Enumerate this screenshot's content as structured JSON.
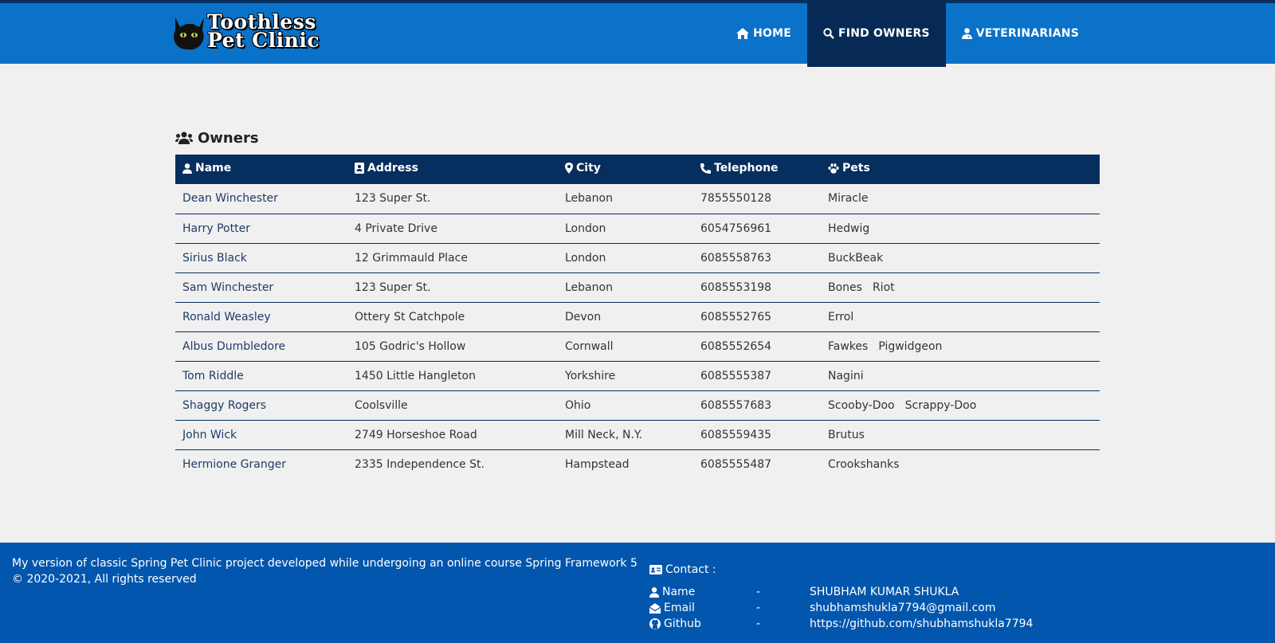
{
  "header": {
    "logo_line1": "Toothless",
    "logo_line2": "Pet Clinic",
    "nav": [
      {
        "label": "HOME",
        "icon": "home-icon"
      },
      {
        "label": "FIND OWNERS",
        "icon": "search-icon",
        "active": true
      },
      {
        "label": "VETERINARIANS",
        "icon": "user-md-icon"
      }
    ]
  },
  "main": {
    "title": "Owners",
    "columns": [
      "Name",
      "Address",
      "City",
      "Telephone",
      "Pets"
    ],
    "rows": [
      {
        "name": "Dean Winchester",
        "address": "123 Super St.",
        "city": "Lebanon",
        "telephone": "7855550128",
        "pets": [
          "Miracle"
        ]
      },
      {
        "name": "Harry Potter",
        "address": "4 Private Drive",
        "city": "London",
        "telephone": "6054756961",
        "pets": [
          "Hedwig"
        ]
      },
      {
        "name": "Sirius Black",
        "address": "12 Grimmauld Place",
        "city": "London",
        "telephone": "6085558763",
        "pets": [
          "BuckBeak"
        ]
      },
      {
        "name": "Sam Winchester",
        "address": "123 Super St.",
        "city": "Lebanon",
        "telephone": "6085553198",
        "pets": [
          "Bones",
          "Riot"
        ]
      },
      {
        "name": "Ronald Weasley",
        "address": "Ottery St Catchpole",
        "city": "Devon",
        "telephone": "6085552765",
        "pets": [
          "Errol"
        ]
      },
      {
        "name": "Albus Dumbledore",
        "address": "105 Godric's Hollow",
        "city": "Cornwall",
        "telephone": "6085552654",
        "pets": [
          "Fawkes",
          "Pigwidgeon"
        ]
      },
      {
        "name": "Tom Riddle",
        "address": "1450 Little Hangleton",
        "city": "Yorkshire",
        "telephone": "6085555387",
        "pets": [
          "Nagini"
        ]
      },
      {
        "name": "Shaggy Rogers",
        "address": "Coolsville",
        "city": "Ohio",
        "telephone": "6085557683",
        "pets": [
          "Scooby-Doo",
          "Scrappy-Doo"
        ]
      },
      {
        "name": "John Wick",
        "address": "2749 Horseshoe Road",
        "city": "Mill Neck, N.Y.",
        "telephone": "6085559435",
        "pets": [
          "Brutus"
        ]
      },
      {
        "name": "Hermione Granger",
        "address": "2335 Independence St.",
        "city": "Hampstead",
        "telephone": "6085555487",
        "pets": [
          "Crookshanks"
        ]
      }
    ]
  },
  "footer": {
    "description": "My version of classic Spring Pet Clinic project developed while undergoing an online course Spring Framework 5",
    "copyright": "© 2020-2021, All rights reserved",
    "contact_title": "Contact :",
    "contact": [
      {
        "label": "Name",
        "dash": "-",
        "value": "SHUBHAM KUMAR SHUKLA",
        "icon": "user-icon"
      },
      {
        "label": "Email",
        "dash": "-",
        "value": "shubhamshukla7794@gmail.com",
        "icon": "envelope-open-icon"
      },
      {
        "label": "Github",
        "dash": "-",
        "value": "https://github.com/shubhamshukla7794",
        "icon": "github-icon"
      }
    ]
  },
  "colors": {
    "header_bg": "#0a72c9",
    "nav_active": "#062a55",
    "table_head": "#062e5e",
    "footer_bg": "#0356ad",
    "page_bg": "#f0f0f0"
  }
}
